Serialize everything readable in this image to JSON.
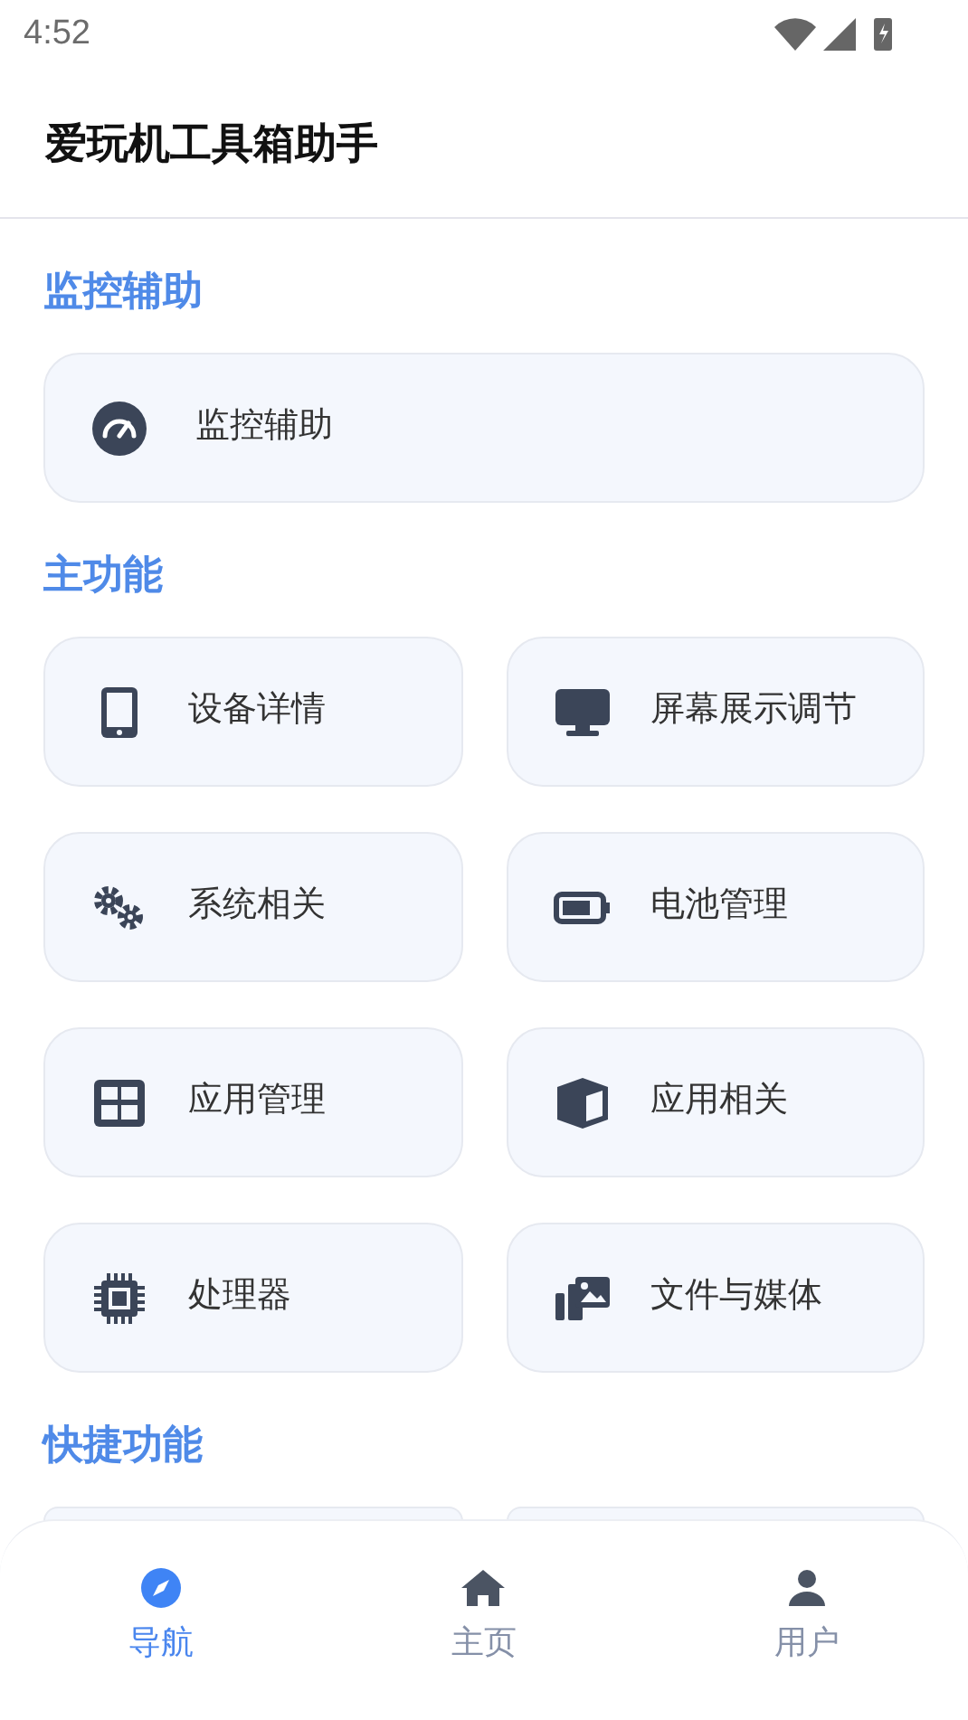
{
  "status_bar": {
    "time": "4:52"
  },
  "app_bar": {
    "title": "爱玩机工具箱助手"
  },
  "sections": [
    {
      "title": "监控辅助",
      "kind": "single",
      "items": [
        {
          "label": "监控辅助"
        }
      ]
    },
    {
      "title": "主功能",
      "kind": "grid",
      "items": [
        {
          "label": "设备详情"
        },
        {
          "label": "屏幕展示调节"
        },
        {
          "label": "系统相关"
        },
        {
          "label": "电池管理"
        },
        {
          "label": "应用管理"
        },
        {
          "label": "应用相关"
        },
        {
          "label": "处理器"
        },
        {
          "label": "文件与媒体"
        }
      ]
    },
    {
      "title": "快捷功能",
      "kind": "grid",
      "items": [
        {
          "kind": "cut"
        },
        {
          "kind": "cut"
        }
      ]
    }
  ],
  "bottom_nav": [
    {
      "label": "导航",
      "selected": true
    },
    {
      "label": "主页",
      "selected": false
    },
    {
      "label": "用户",
      "selected": false
    }
  ]
}
